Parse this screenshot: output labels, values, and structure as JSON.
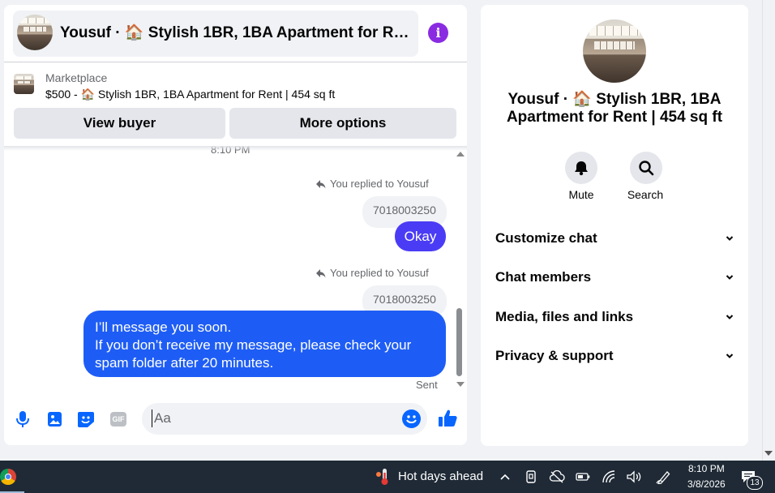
{
  "chat": {
    "title": "Yousuf · 🏠 Stylish 1BR, 1BA Apartment for Rent | 454 sq ft",
    "marketplace_label": "Marketplace",
    "listing": "$500 - 🏠 Stylish 1BR, 1BA Apartment for Rent | 454 sq ft",
    "view_buyer": "View buyer",
    "more_options": "More options",
    "time_stub": "8:10 PM",
    "messages": [
      {
        "replied_label": "You replied to Yousuf",
        "quoted": "7018003250",
        "text": "Okay"
      },
      {
        "replied_label": "You replied to Yousuf",
        "quoted": "7018003250",
        "line1": "I’ll message you soon.",
        "line2": "If you don’t receive my message, please check your spam folder after 20 minutes."
      }
    ],
    "sent_label": "Sent",
    "input_placeholder": "Aa",
    "accent_color": "#0866ff",
    "tools": [
      "microphone-icon",
      "image-icon",
      "sticker-icon",
      "gif-icon",
      "emoji-icon",
      "like-icon"
    ],
    "gif_label": "GIF"
  },
  "info": {
    "title": "Yousuf · 🏠 Stylish 1BR, 1BA Apartment for Rent | 454 sq ft",
    "mute_label": "Mute",
    "search_label": "Search",
    "sections": [
      "Customize chat",
      "Chat members",
      "Media, files and links",
      "Privacy & support"
    ]
  },
  "taskbar": {
    "weather": "Hot days ahead",
    "time": "8:10 PM",
    "date": "3/8/2026",
    "notification_count": "13"
  }
}
